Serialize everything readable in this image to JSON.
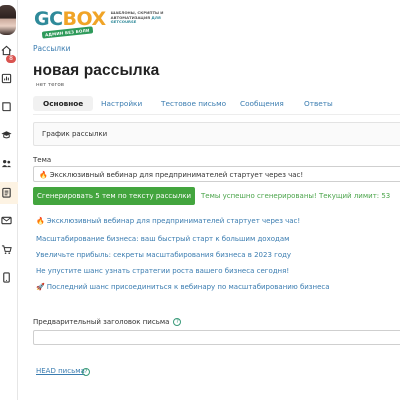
{
  "sidebar": {
    "badge_count": "8",
    "items": [
      {
        "icon": "home-icon"
      },
      {
        "icon": "dashboard-icon"
      },
      {
        "icon": "book-icon"
      },
      {
        "icon": "graduation-cap-icon"
      },
      {
        "icon": "users-icon"
      },
      {
        "icon": "tasks-icon"
      },
      {
        "icon": "mail-icon"
      },
      {
        "icon": "cart-icon"
      },
      {
        "icon": "mobile-icon"
      }
    ]
  },
  "logo": {
    "mark_gc": "GC",
    "mark_box": "BOX",
    "subtitle": "ШАБЛОНЫ, СКРИПТЫ И АВТОМАТИЗАЦИЯ",
    "subtitle_accent": "ДЛЯ GETCOURSE",
    "tag": "АДМИН БЕЗ БОЛИ"
  },
  "breadcrumb": "Рассылки",
  "page": {
    "title": "новая рассылка",
    "tags": "нет тегов"
  },
  "tabs": [
    {
      "label": "Основное",
      "active": true
    },
    {
      "label": "Настройки"
    },
    {
      "label": "Тестовое письмо"
    },
    {
      "label": "Сообщения"
    },
    {
      "label": "Ответы"
    }
  ],
  "schedule_panel": "График рассылки",
  "subject": {
    "label": "Тема",
    "value": "Эксклюзивный вебинар для предпринимателей стартует через час!"
  },
  "generate": {
    "button_label": "Сгенерировать 5 тем по тексту рассылки",
    "status": "Темы успешно сгенерированы! Текущий лимит: 53"
  },
  "suggestions": [
    {
      "emoji": "🔥",
      "text": "Эксклюзивный вебинар для предпринимателей стартует через час!"
    },
    {
      "emoji": "",
      "text": "Масштабирование бизнеса: ваш быстрый старт к большим доходам"
    },
    {
      "emoji": "",
      "text": "Увеличьте прибыль: секреты масштабирования бизнеса в 2023 году"
    },
    {
      "emoji": "",
      "text": "Не упустите шанс узнать стратегии роста вашего бизнеса сегодня!"
    },
    {
      "emoji": "🚀",
      "text": "Последний шанс присоединиться к вебинару по масштабированию бизнеса"
    }
  ],
  "preheader": {
    "label": "Предварительный заголовок письма",
    "value": "",
    "help": "?"
  },
  "head_link": {
    "label": "HEAD письма",
    "help": "?"
  }
}
